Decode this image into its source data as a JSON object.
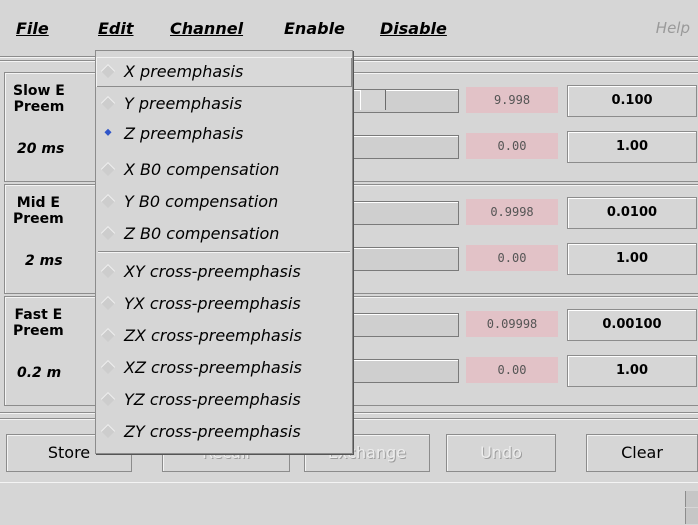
{
  "menubar": {
    "items": [
      {
        "label": "File"
      },
      {
        "label": "Edit"
      },
      {
        "label": "Channel"
      },
      {
        "label": "Enable"
      },
      {
        "label": "Disable"
      }
    ],
    "help": "Help"
  },
  "groups": [
    {
      "label_line1": "Slow E",
      "label_line2": "Preem",
      "time": "20 ms",
      "rows": [
        {
          "value": "9.998",
          "setting": "0.100"
        },
        {
          "value": "0.00",
          "setting": "1.00"
        }
      ]
    },
    {
      "label_line1": "Mid E",
      "label_line2": "Preem",
      "time": "2 ms",
      "rows": [
        {
          "value": "0.9998",
          "setting": "0.0100"
        },
        {
          "value": "0.00",
          "setting": "1.00"
        }
      ]
    },
    {
      "label_line1": "Fast E",
      "label_line2": "Preem",
      "time": "0.2 m",
      "rows": [
        {
          "value": "0.09998",
          "setting": "0.00100"
        },
        {
          "value": "0.00",
          "setting": "1.00"
        }
      ]
    }
  ],
  "buttons": {
    "store": "Store",
    "recall": "Recall",
    "exchange": "Exchange",
    "undo": "Undo",
    "clear": "Clear"
  },
  "dropdown": {
    "items": [
      {
        "label": "X preemphasis",
        "selected": false
      },
      {
        "label": "Y preemphasis",
        "selected": false
      },
      {
        "label": "Z preemphasis",
        "selected": true
      },
      {
        "label": "X B0 compensation",
        "selected": false
      },
      {
        "label": "Y B0 compensation",
        "selected": false
      },
      {
        "label": "Z B0 compensation",
        "selected": false
      },
      {
        "label": "XY cross-preemphasis",
        "selected": false
      },
      {
        "label": "YX cross-preemphasis",
        "selected": false
      },
      {
        "label": "ZX cross-preemphasis",
        "selected": false
      },
      {
        "label": "XZ cross-preemphasis",
        "selected": false
      },
      {
        "label": "YZ cross-preemphasis",
        "selected": false
      },
      {
        "label": "ZY cross-preemphasis",
        "selected": false
      }
    ]
  },
  "colors": {
    "value_bg": "#e2c2c7",
    "selected_indicator": "#2f55c8"
  }
}
